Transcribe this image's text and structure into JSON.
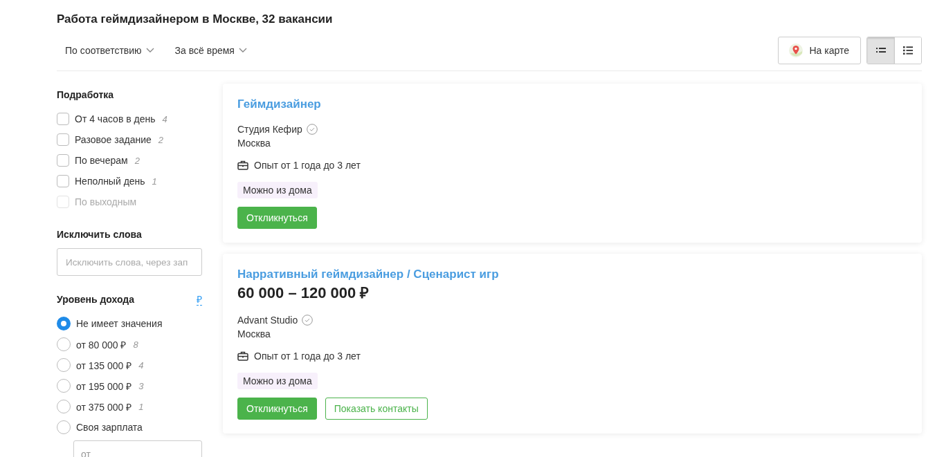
{
  "title": "Работа геймдизайнером в Москве, 32 вакансии",
  "sort_options": [
    {
      "label": "По соответствию"
    },
    {
      "label": "За всё время"
    }
  ],
  "map_button": {
    "label": "На карте"
  },
  "view_toggle": [
    {
      "kind": "compact",
      "selected": true
    },
    {
      "kind": "detailed",
      "selected": false
    }
  ],
  "filters": {
    "part_time": {
      "title": "Подработка",
      "items": [
        {
          "label": "От 4 часов в день",
          "count": "4",
          "checked": false,
          "disabled": false
        },
        {
          "label": "Разовое задание",
          "count": "2",
          "checked": false,
          "disabled": false
        },
        {
          "label": "По вечерам",
          "count": "2",
          "checked": false,
          "disabled": false
        },
        {
          "label": "Неполный день",
          "count": "1",
          "checked": false,
          "disabled": false
        },
        {
          "label": "По выходным",
          "checked": false,
          "disabled": true
        }
      ]
    },
    "exclude_words": {
      "title": "Исключить слова",
      "placeholder": "Исключить слова, через зап"
    },
    "income": {
      "title": "Уровень дохода",
      "currency": "₽",
      "options": [
        {
          "label": "Не имеет значения",
          "selected": true
        },
        {
          "label": "от 80 000 ₽",
          "count": "8",
          "selected": false
        },
        {
          "label": "от 135 000 ₽",
          "count": "4",
          "selected": false
        },
        {
          "label": "от 195 000 ₽",
          "count": "3",
          "selected": false
        },
        {
          "label": "от 375 000 ₽",
          "count": "1",
          "selected": false
        },
        {
          "label": "Своя зарплата",
          "selected": false
        }
      ],
      "custom_placeholder": "от"
    }
  },
  "vacancies": [
    {
      "title": "Геймдизайнер",
      "company": "Студия Кефир",
      "verified": true,
      "city": "Москва",
      "experience": "Опыт от 1 года до 3 лет",
      "tags": [
        "Можно из дома"
      ],
      "buttons": [
        {
          "kind": "primary",
          "label": "Откликнуться"
        }
      ]
    },
    {
      "title": "Нарративный геймдизайнер / Сценарист игр",
      "salary": "60 000 – 120 000 ₽",
      "company": "Advant Studio",
      "verified": true,
      "city": "Москва",
      "experience": "Опыт от 1 года до 3 лет",
      "tags": [
        "Можно из дома"
      ],
      "buttons": [
        {
          "kind": "primary",
          "label": "Откликнуться"
        },
        {
          "kind": "outline",
          "label": "Показать контакты"
        }
      ]
    }
  ]
}
